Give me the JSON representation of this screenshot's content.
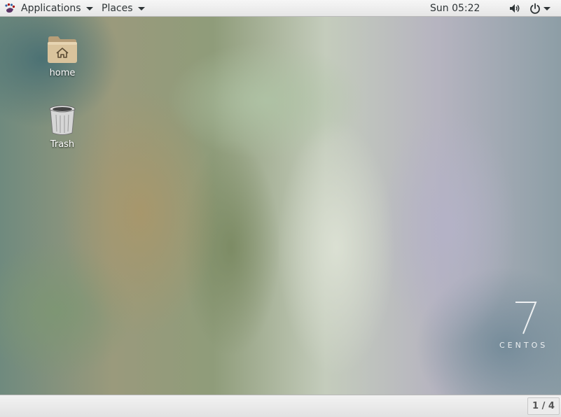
{
  "top_panel": {
    "applications_label": "Applications",
    "places_label": "Places",
    "clock": "Sun 05:22",
    "icons": {
      "applications": "gnome-foot-icon",
      "volume": "speaker-icon",
      "power": "power-icon",
      "menu_arrow": "chevron-down-icon"
    }
  },
  "desktop": {
    "icons": [
      {
        "label": "home",
        "icon": "home-folder-icon"
      },
      {
        "label": "Trash",
        "icon": "trash-icon"
      }
    ],
    "watermark": {
      "number": "7",
      "text": "CENTOS"
    }
  },
  "bottom_panel": {
    "workspace": "1 / 4"
  },
  "colors": {
    "panel_bg": "#ececec",
    "panel_text": "#2e3436",
    "folder": "#d9c39c"
  }
}
